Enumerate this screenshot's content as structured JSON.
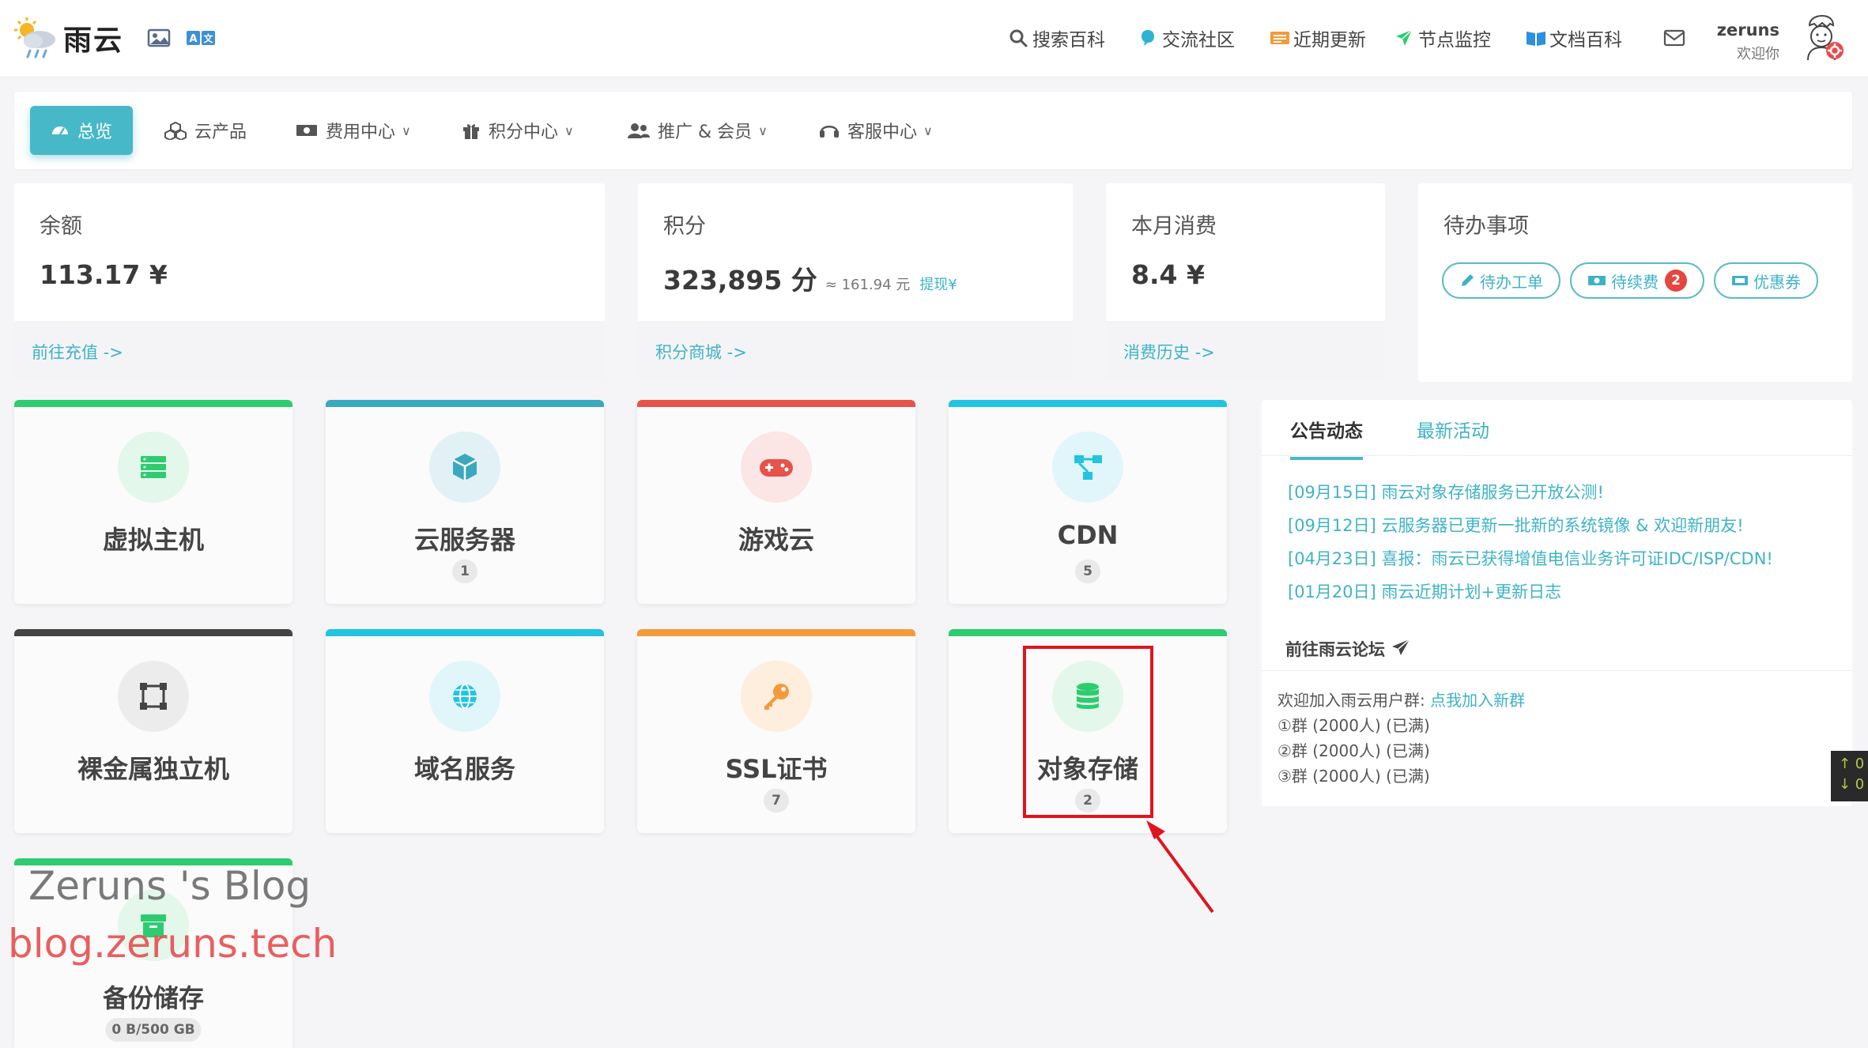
{
  "header": {
    "logo_text": "雨云",
    "nav": [
      {
        "label": "搜索百科",
        "icon": "search-icon"
      },
      {
        "label": "交流社区",
        "icon": "chat-bubble-icon"
      },
      {
        "label": "近期更新",
        "icon": "update-list-icon"
      },
      {
        "label": "节点监控",
        "icon": "send-arrow-icon"
      },
      {
        "label": "文档百科",
        "icon": "book-icon"
      }
    ],
    "mail_icon": "mail-icon",
    "user": {
      "name": "zeruns",
      "greeting": "欢迎你"
    }
  },
  "subnav": [
    {
      "label": "总览",
      "icon": "dashboard-icon",
      "active": true
    },
    {
      "label": "云产品",
      "icon": "cubes-icon"
    },
    {
      "label": "费用中心",
      "icon": "money-icon",
      "dropdown": true
    },
    {
      "label": "积分中心",
      "icon": "gift-icon",
      "dropdown": true
    },
    {
      "label": "推广 & 会员",
      "icon": "users-icon",
      "dropdown": true
    },
    {
      "label": "客服中心",
      "icon": "headset-icon",
      "dropdown": true
    }
  ],
  "stats": {
    "balance": {
      "title": "余额",
      "value": "113.17 ¥",
      "link": "前往充值 ->"
    },
    "points": {
      "title": "积分",
      "value": "323,895 分",
      "sub": "≈ 161.94 元",
      "sub_link": "提现¥",
      "link": "积分商城 ->"
    },
    "monthly": {
      "title": "本月消费",
      "value": "8.4 ¥",
      "link": "消费历史 ->"
    },
    "todo": {
      "title": "待办事项",
      "buttons": [
        {
          "label": "待办工单",
          "icon": "pencil-icon"
        },
        {
          "label": "待续费",
          "icon": "money-icon",
          "badge": "2"
        },
        {
          "label": "优惠券",
          "icon": "ticket-icon"
        }
      ]
    }
  },
  "products": [
    {
      "name": "虚拟主机",
      "count": "",
      "icon": "server-icon",
      "color": "#2ecc71"
    },
    {
      "name": "云服务器",
      "count": "1",
      "icon": "cube-icon",
      "color": "#3aa8bf"
    },
    {
      "name": "游戏云",
      "count": "",
      "icon": "gamepad-icon",
      "color": "#e5534b"
    },
    {
      "name": "CDN",
      "count": "5",
      "icon": "network-icon",
      "color": "#22c4e2"
    },
    {
      "name": "裸金属独立机",
      "count": "",
      "icon": "bare-metal-icon",
      "color": "#444444"
    },
    {
      "name": "域名服务",
      "count": "",
      "icon": "globe-icon",
      "color": "#22c4e2"
    },
    {
      "name": "SSL证书",
      "count": "7",
      "icon": "key-icon",
      "color": "#f39a3c"
    },
    {
      "name": "对象存储",
      "count": "2",
      "icon": "database-icon",
      "color": "#2ecc71"
    },
    {
      "name": "备份储存",
      "count": "0 B/500 GB",
      "icon": "archive-icon",
      "color": "#2ecc71"
    }
  ],
  "news": {
    "tabs": [
      "公告动态",
      "最新活动"
    ],
    "items": [
      "[09月15日] 雨云对象存储服务已开放公测!",
      "[09月12日] 云服务器已更新一批新的系统镜像 & 欢迎新朋友!",
      "[04月23日] 喜报：雨云已获得增值电信业务许可证IDC/ISP/CDN!",
      "[01月20日] 雨云近期计划+更新日志"
    ],
    "forum_link": "前往雨云论坛",
    "group_intro": "欢迎加入雨云用户群:",
    "group_join_link": "点我加入新群",
    "groups": [
      "①群 (2000人) (已满)",
      "②群 (2000人) (已满)",
      "③群 (2000人) (已满)"
    ]
  },
  "speed_widget": {
    "up": "↑ 0",
    "down": "↓ 0"
  },
  "watermark": {
    "line1": "Zeruns 's Blog",
    "line2": "blog.zeruns.tech"
  }
}
